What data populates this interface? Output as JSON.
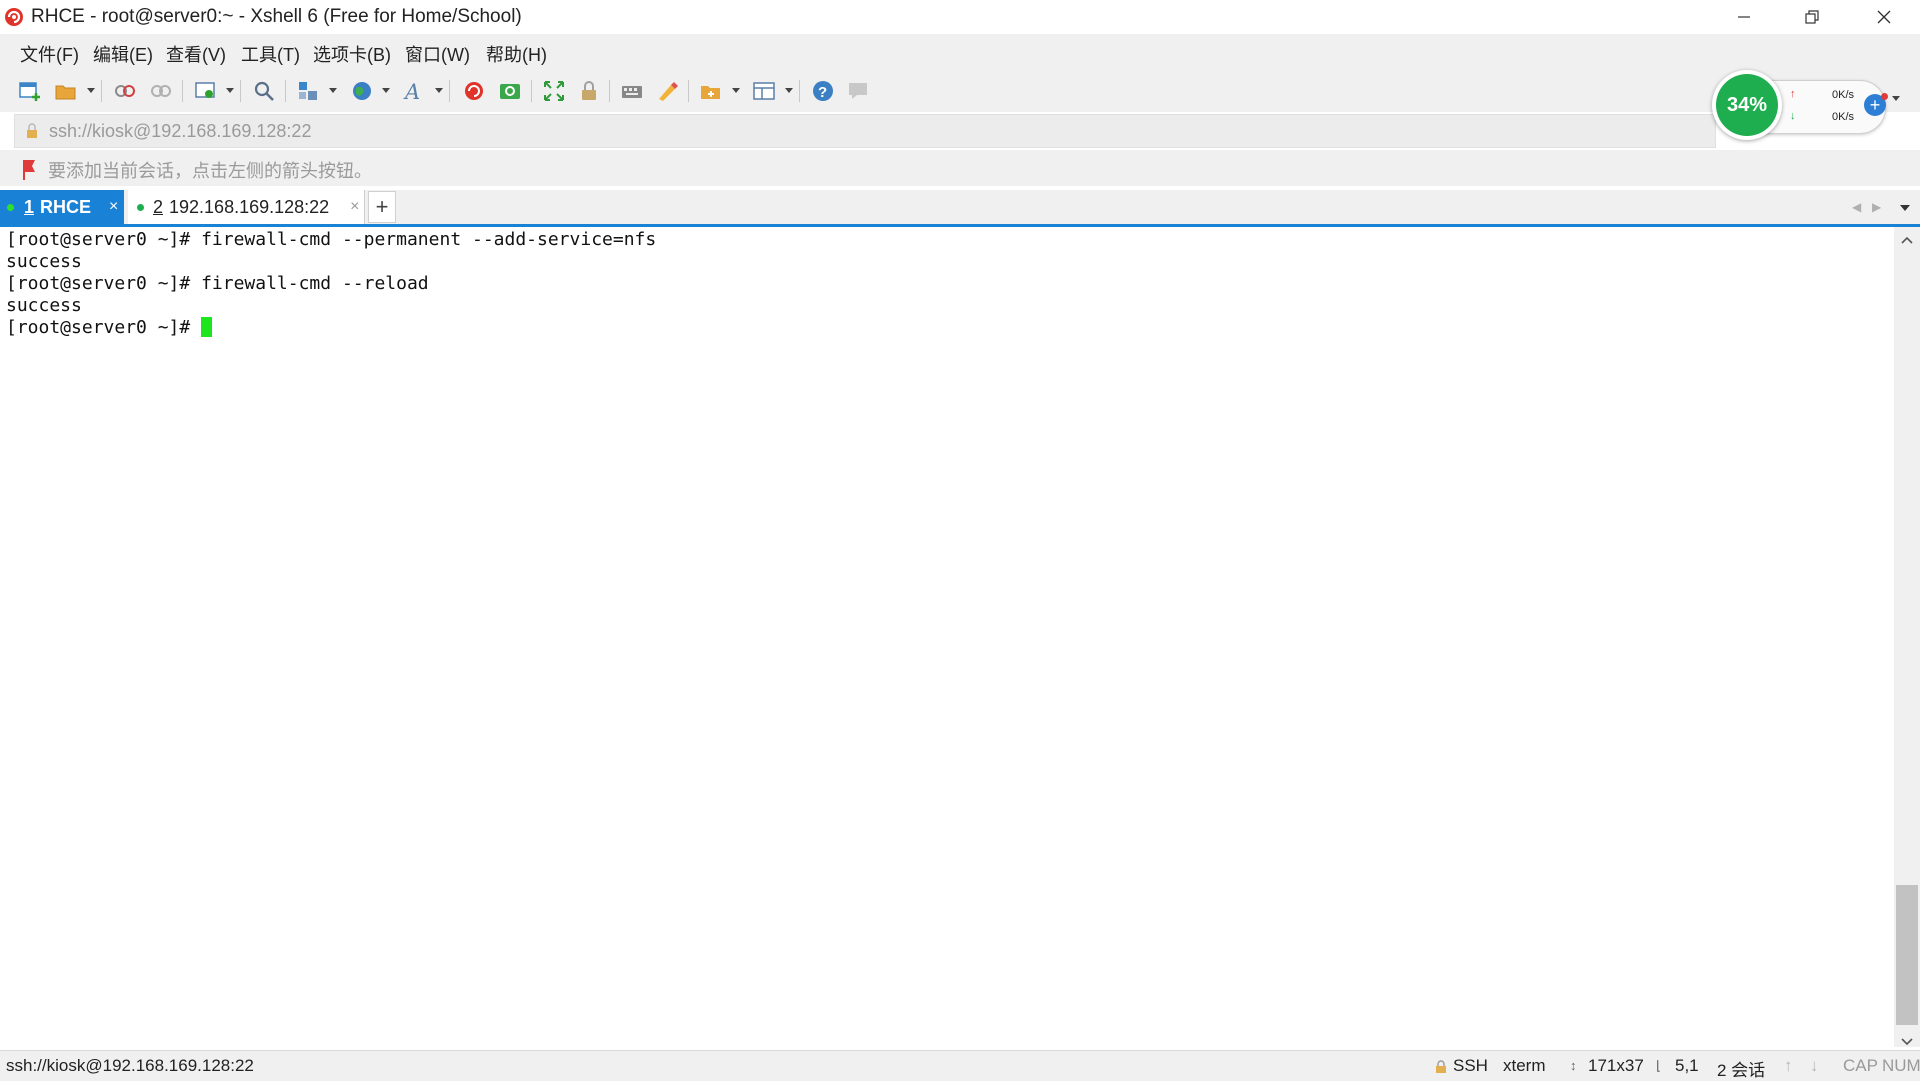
{
  "window": {
    "title": "RHCE - root@server0:~ - Xshell 6 (Free for Home/School)"
  },
  "menu": [
    "文件(F)",
    "编辑(E)",
    "查看(V)",
    "工具(T)",
    "选项卡(B)",
    "窗口(W)",
    "帮助(H)"
  ],
  "address": {
    "value": "ssh://kiosk@192.168.169.128:22"
  },
  "hint": {
    "text": "要添加当前会话，点击左侧的箭头按钮。"
  },
  "network": {
    "cpu_percent": "34%",
    "upload": "0K/s",
    "download": "0K/s"
  },
  "tabs": [
    {
      "num": "1",
      "label": "RHCE",
      "active": true
    },
    {
      "num": "2",
      "label": "192.168.169.128:22",
      "active": false
    }
  ],
  "new_tab_label": "+",
  "terminal": {
    "lines": [
      "[root@server0 ~]# firewall-cmd --permanent --add-service=nfs",
      "success",
      "[root@server0 ~]# firewall-cmd --reload",
      "success",
      "[root@server0 ~]# "
    ]
  },
  "status": {
    "connection": "ssh://kiosk@192.168.169.128:22",
    "protocol": "SSH",
    "terminal_type": "xterm",
    "size": "171x37",
    "cursor_pos": "5,1",
    "sessions": "2 会话",
    "cap": "CAP",
    "num": "NUM"
  },
  "colors": {
    "accent": "#1a82d6",
    "cursor": "#1ee61e",
    "active_tab": "#1a82d6",
    "cpu_ring": "#1fae4f"
  }
}
